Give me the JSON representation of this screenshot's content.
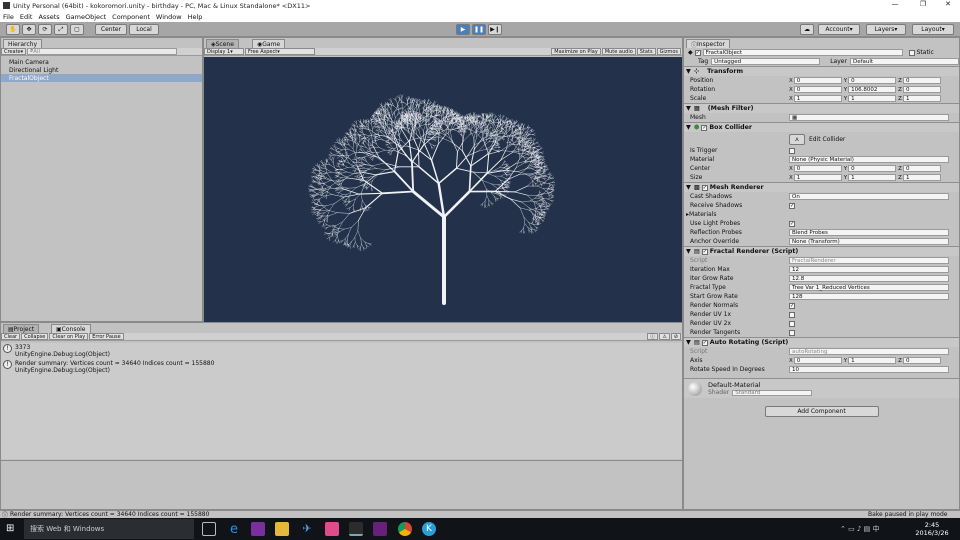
{
  "window": {
    "title": "Unity Personal (64bit) - kokoromori.unity - birthday - PC, Mac & Linux Standalone* <DX11>"
  },
  "menu": [
    "File",
    "Edit",
    "Assets",
    "GameObject",
    "Component",
    "Window",
    "Help"
  ],
  "toolbar": {
    "center_label": "Center",
    "local_label": "Local",
    "account_label": "Account",
    "layers_label": "Layers",
    "layout_label": "Layout"
  },
  "hierarchy": {
    "tab_label": "Hierarchy",
    "create_label": "Create",
    "search_placeholder": "All",
    "items": [
      "Main Camera",
      "Directional Light",
      "FractalObject"
    ]
  },
  "view": {
    "scene_tab": "Scene",
    "game_tab": "Game",
    "display": "Display 1",
    "aspect": "Free Aspect",
    "buttons": [
      "Maximize on Play",
      "Mute audio",
      "Stats",
      "Gizmos"
    ]
  },
  "console": {
    "project_tab": "Project",
    "console_tab": "Console",
    "buttons": [
      "Clear",
      "Collapse",
      "Clear on Play",
      "Error Pause"
    ],
    "entries": [
      {
        "line1": "3373",
        "line2": "UnityEngine.Debug:Log(Object)"
      },
      {
        "line1": "Render summary: Vertices count = 34640 Indices count = 155880",
        "line2": "UnityEngine.Debug:Log(Object)"
      }
    ]
  },
  "status": {
    "message": "Render summary: Vertices count = 34640 Indices count = 155880",
    "right": "Bake paused in play mode"
  },
  "inspector": {
    "tab_label": "Inspector",
    "object_name": "FractalObject",
    "static_label": "Static",
    "tag_label": "Tag",
    "tag_value": "Untagged",
    "layer_label": "Layer",
    "layer_value": "Default",
    "transform": {
      "title": "Transform",
      "position_label": "Position",
      "position": [
        "0",
        "0",
        "0"
      ],
      "rotation_label": "Rotation",
      "rotation": [
        "0",
        "106.8002",
        "0"
      ],
      "scale_label": "Scale",
      "scale": [
        "1",
        "1",
        "1"
      ]
    },
    "mesh_filter": {
      "title": "(Mesh Filter)",
      "mesh_label": "Mesh",
      "mesh_value": ""
    },
    "box_collider": {
      "title": "Box Collider",
      "edit_label": "Edit Collider",
      "is_trigger_label": "Is Trigger",
      "material_label": "Material",
      "material_value": "None (Physic Material)",
      "center_label": "Center",
      "center": [
        "0",
        "0",
        "0"
      ],
      "size_label": "Size",
      "size": [
        "1",
        "1",
        "1"
      ]
    },
    "mesh_renderer": {
      "title": "Mesh Renderer",
      "cast_shadows_label": "Cast Shadows",
      "cast_shadows_value": "On",
      "receive_shadows_label": "Receive Shadows",
      "materials_label": "Materials",
      "light_probes_label": "Use Light Probes",
      "reflection_label": "Reflection Probes",
      "reflection_value": "Blend Probes",
      "anchor_label": "Anchor Override",
      "anchor_value": "None (Transform)"
    },
    "fractal_renderer": {
      "title": "Fractal Renderer (Script)",
      "script_label": "Script",
      "script_value": "FractalRenderer",
      "iteration_label": "Iteration Max",
      "iteration_value": "12",
      "iter_grow_label": "Iter Grow Rate",
      "iter_grow_value": "12.8",
      "type_label": "Fractal Type",
      "type_value": "Tree Var 1_Reduced Vertices",
      "start_grow_label": "Start Grow Rate",
      "start_grow_value": "128",
      "normals_label": "Render Normals",
      "uv1_label": "Render UV 1x",
      "uv2_label": "Render UV 2x",
      "tangents_label": "Render Tangents"
    },
    "auto_rotating": {
      "title": "Auto Rotating (Script)",
      "script_label": "Script",
      "script_value": "autoRotating",
      "axis_label": "Axis",
      "axis": [
        "0",
        "1",
        "0"
      ],
      "speed_label": "Rotate Speed In Degrees",
      "speed_value": "10"
    },
    "material": {
      "name": "Default-Material",
      "shader_label": "Shader",
      "shader_value": "Standard"
    },
    "add_component": "Add Component"
  },
  "taskbar": {
    "search_text": "搜索 Web 和 Windows",
    "time": "2:45",
    "date": "2016/3/26"
  },
  "colors": {
    "game_bg": "#23324a",
    "accent": "#4d7cbf"
  }
}
